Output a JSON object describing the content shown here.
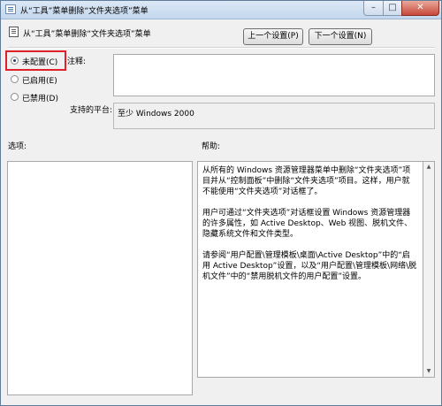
{
  "window": {
    "title": "从“工具”菜单删除“文件夹选项”菜单",
    "minimize_glyph": "–",
    "maximize_glyph": "□",
    "close_glyph": "✕"
  },
  "header": {
    "policy_title": "从“工具”菜单删除“文件夹选项”菜单",
    "prev_button": "上一个设置(P)",
    "next_button": "下一个设置(N)"
  },
  "state": {
    "options": [
      {
        "label": "未配置(C)",
        "checked": true
      },
      {
        "label": "已启用(E)",
        "checked": false
      },
      {
        "label": "已禁用(D)",
        "checked": false
      }
    ]
  },
  "comment": {
    "label": "注释:",
    "value": ""
  },
  "platform": {
    "label": "支持的平台:",
    "value": "至少 Windows 2000"
  },
  "options_label": "选项:",
  "help": {
    "label": "帮助:",
    "paragraphs": [
      "从所有的 Windows 资源管理器菜单中删除“文件夹选项”项目并从“控制面板”中删除“文件夹选项”项目。这样，用户就不能使用“文件夹选项”对话框了。",
      "用户可通过“文件夹选项”对话框设置 Windows 资源管理器的许多属性，如 Active Desktop、Web 视图、脱机文件、隐藏系统文件和文件类型。",
      "请参阅“用户配置\\管理模板\\桌面\\Active Desktop”中的“启用 Active Desktop”设置，以及“用户配置\\管理模板\\网络\\脱机文件”中的“禁用脱机文件的用户配置”设置。"
    ]
  },
  "icons": {
    "window": "policy-window-icon",
    "policy": "policy-doc-icon",
    "scroll_up": "▲",
    "scroll_down": "▼"
  }
}
